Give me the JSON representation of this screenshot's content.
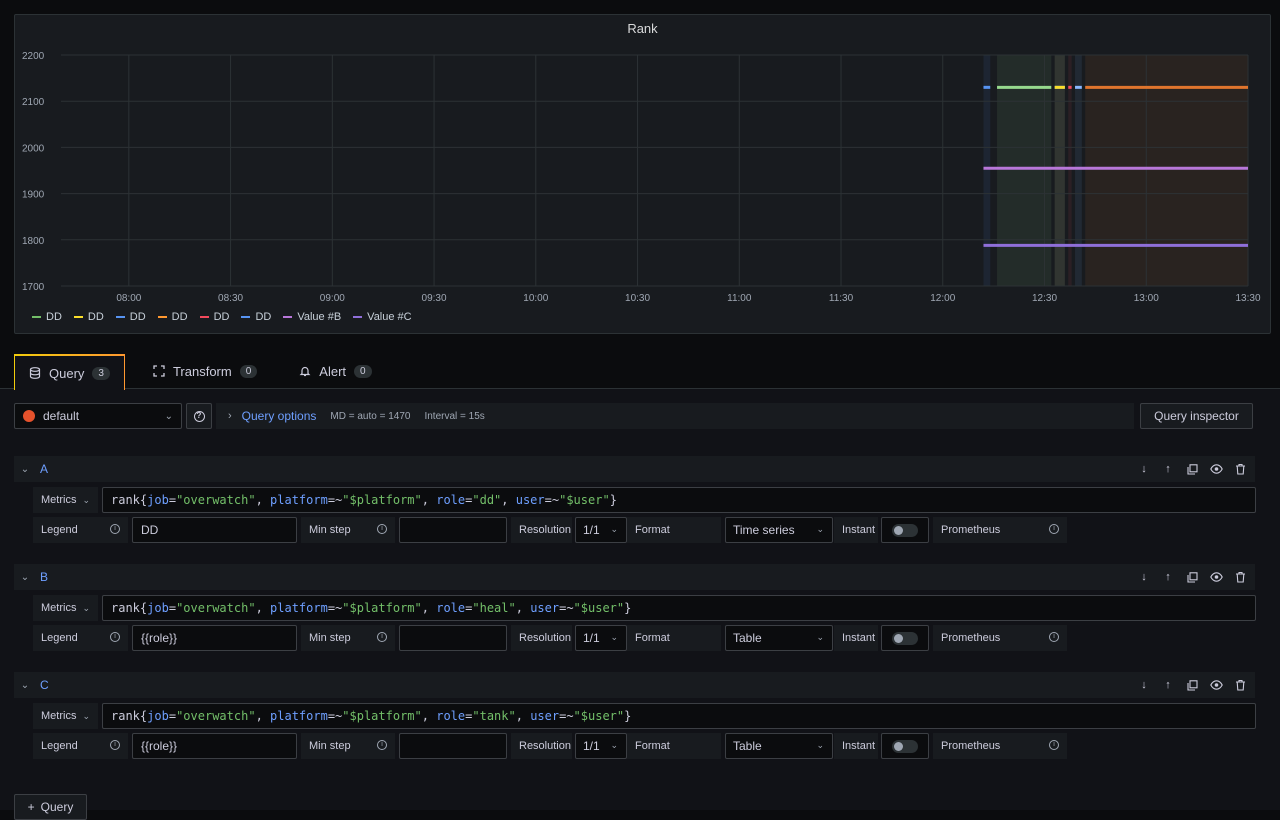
{
  "panel": {
    "title": "Rank"
  },
  "chart_data": {
    "type": "line",
    "title": "Rank",
    "ylim": [
      1700,
      2200
    ],
    "yticks": [
      2200,
      2100,
      2000,
      1900,
      1800,
      1700
    ],
    "xticks": [
      "08:00",
      "08:30",
      "09:00",
      "09:30",
      "10:00",
      "10:30",
      "11:00",
      "11:30",
      "12:00",
      "12:30",
      "13:00",
      "13:30"
    ],
    "xlim": [
      "07:40",
      "13:30"
    ],
    "grid": true,
    "legend_placement": "bottom-left",
    "series": [
      {
        "name": "DD",
        "color": "#5794f2",
        "x": [
          "12:12",
          "12:14"
        ],
        "y": [
          2130,
          2130
        ]
      },
      {
        "name": "DD",
        "color": "#96d98d",
        "x": [
          "12:16",
          "12:32"
        ],
        "y": [
          2130,
          2130
        ]
      },
      {
        "name": "DD",
        "color": "#5794f2",
        "x": [
          "12:33",
          "12:36"
        ],
        "y": [
          2130,
          2130
        ]
      },
      {
        "name": "DD",
        "color": "#fade2a",
        "x": [
          "12:33",
          "12:36"
        ],
        "y": [
          2130,
          2130
        ]
      },
      {
        "name": "DD",
        "color": "#f2495c",
        "x": [
          "12:37",
          "12:38"
        ],
        "y": [
          2130,
          2130
        ]
      },
      {
        "name": "DD",
        "color": "#8ab8ff",
        "x": [
          "12:39",
          "12:41"
        ],
        "y": [
          2130,
          2130
        ]
      },
      {
        "name": "DD",
        "color": "#e0752d",
        "x": [
          "12:42",
          "13:30"
        ],
        "y": [
          2130,
          2130
        ]
      },
      {
        "name": "Value #B",
        "color": "#b877d9",
        "x": [
          "12:12",
          "13:30"
        ],
        "y": [
          1955,
          1955
        ]
      },
      {
        "name": "Value #C",
        "color": "#8f6fd9",
        "x": [
          "12:12",
          "13:30"
        ],
        "y": [
          1788,
          1788
        ]
      }
    ],
    "legend": [
      {
        "label": "DD",
        "color": "#73bf69"
      },
      {
        "label": "DD",
        "color": "#fade2a"
      },
      {
        "label": "DD",
        "color": "#5794f2"
      },
      {
        "label": "DD",
        "color": "#ff9830"
      },
      {
        "label": "DD",
        "color": "#f2495c"
      },
      {
        "label": "DD",
        "color": "#5794f2"
      },
      {
        "label": "Value #B",
        "color": "#b877d9"
      },
      {
        "label": "Value #C",
        "color": "#8f6fd9"
      }
    ]
  },
  "tabs": [
    {
      "label": "Query",
      "count": "3",
      "icon": "database-icon"
    },
    {
      "label": "Transform",
      "count": "0",
      "icon": "transform-icon"
    },
    {
      "label": "Alert",
      "count": "0",
      "icon": "bell-icon"
    }
  ],
  "datasource": {
    "name": "default"
  },
  "query_options": {
    "label": "Query options",
    "md": "MD = auto = 1470",
    "interval": "Interval = 15s"
  },
  "query_inspector": {
    "label": "Query inspector"
  },
  "labels": {
    "metrics": "Metrics",
    "legend": "Legend",
    "min_step": "Min step",
    "resolution": "Resolution",
    "format": "Format",
    "instant": "Instant",
    "prometheus": "Prometheus"
  },
  "queries": [
    {
      "ref": "A",
      "metric": "rank",
      "job": "overwatch",
      "platform": "$platform",
      "role": "dd",
      "user": "$user",
      "legend": "DD",
      "min_step": "",
      "resolution": "1/1",
      "format": "Time series",
      "instant": false
    },
    {
      "ref": "B",
      "metric": "rank",
      "job": "overwatch",
      "platform": "$platform",
      "role": "heal",
      "user": "$user",
      "legend": "{{role}}",
      "min_step": "",
      "resolution": "1/1",
      "format": "Table",
      "instant": false
    },
    {
      "ref": "C",
      "metric": "rank",
      "job": "overwatch",
      "platform": "$platform",
      "role": "tank",
      "user": "$user",
      "legend": "{{role}}",
      "min_step": "",
      "resolution": "1/1",
      "format": "Table",
      "instant": false
    }
  ],
  "add_query": {
    "label": "Query"
  }
}
